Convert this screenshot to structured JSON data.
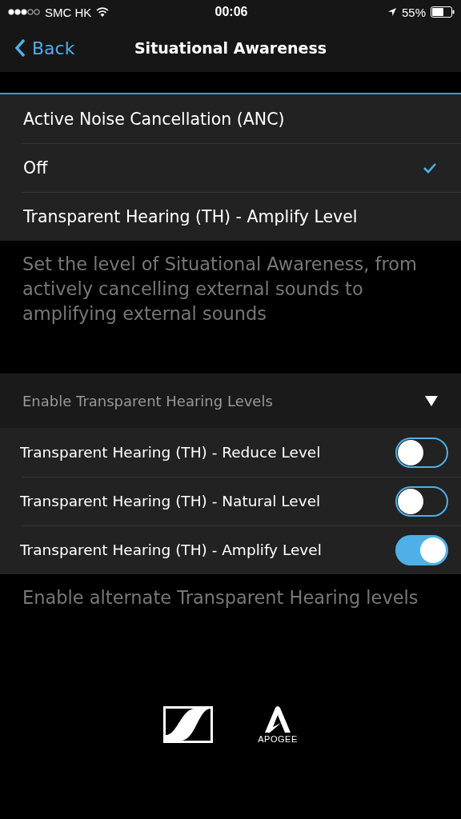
{
  "status_bar": {
    "carrier": "SMC HK",
    "time": "00:06",
    "battery": "55%"
  },
  "nav": {
    "back": "Back",
    "title": "Situational Awareness"
  },
  "options": [
    {
      "label": "Active Noise Cancellation (ANC)",
      "selected": false
    },
    {
      "label": "Off",
      "selected": true
    },
    {
      "label": "Transparent Hearing (TH) - Amplify Level",
      "selected": false
    }
  ],
  "options_footer": "Set the level of Situational Awareness, from actively cancelling external sounds to amplifying external sounds",
  "levels_section": {
    "title": "Enable Transparent Hearing Levels",
    "expanded": true
  },
  "levels": [
    {
      "label": "Transparent Hearing (TH) - Reduce Level",
      "on": false
    },
    {
      "label": "Transparent Hearing (TH) - Natural Level",
      "on": false
    },
    {
      "label": "Transparent Hearing (TH) - Amplify Level",
      "on": true
    }
  ],
  "levels_footer": "Enable alternate Transparent Hearing levels",
  "logos": {
    "apogee": "APOGEE"
  }
}
